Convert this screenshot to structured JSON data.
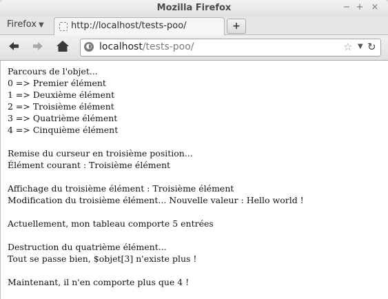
{
  "window": {
    "title": "Mozilla Firefox"
  },
  "firefox_menu": {
    "label": "Firefox"
  },
  "tab": {
    "title": "http://localhost/tests-poo/"
  },
  "address_bar": {
    "host": "localhost",
    "path": "/tests-poo/"
  },
  "content": {
    "group1": [
      "Parcours de l'objet...",
      "0 => Premier élément",
      "1 => Deuxième élément",
      "2 => Troisième élément",
      "3 => Quatrième élément",
      "4 => Cinquième élément"
    ],
    "group2": [
      "Remise du curseur en troisième position...",
      "Élément courant : Troisième élément"
    ],
    "group3": [
      "Affichage du troisième élément : Troisième élément",
      "Modification du troisième élément... Nouvelle valeur : Hello world !"
    ],
    "group4": [
      "Actuellement, mon tableau comporte 5 entrées"
    ],
    "group5": [
      "Destruction du quatrième élément...",
      "Tout se passe bien, $objet[3] n'existe plus !"
    ],
    "group6": [
      "Maintenant, il n'en comporte plus que 4 !"
    ]
  }
}
